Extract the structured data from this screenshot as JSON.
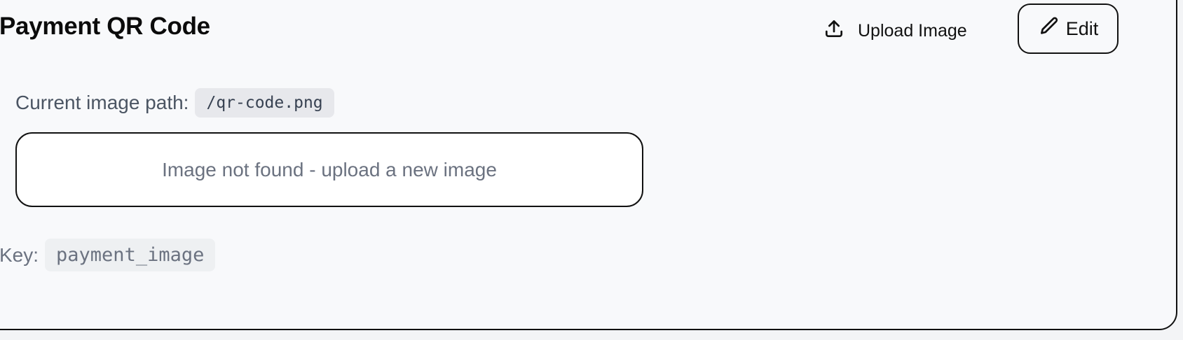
{
  "card": {
    "title": "Payment QR Code",
    "actions": {
      "upload_label": "Upload Image",
      "upload_icon": "upload-icon",
      "edit_label": "Edit",
      "edit_icon": "pencil-icon"
    },
    "image_path": {
      "label": "Current image path:",
      "value": "/qr-code.png"
    },
    "image_placeholder": "Image not found - upload a new image",
    "key": {
      "label": "Key:",
      "value": "payment_image"
    }
  },
  "colors": {
    "background": "#f8f9fb",
    "border": "#111111",
    "muted_text": "#6b7280",
    "chip_bg": "#e7e8ec"
  }
}
